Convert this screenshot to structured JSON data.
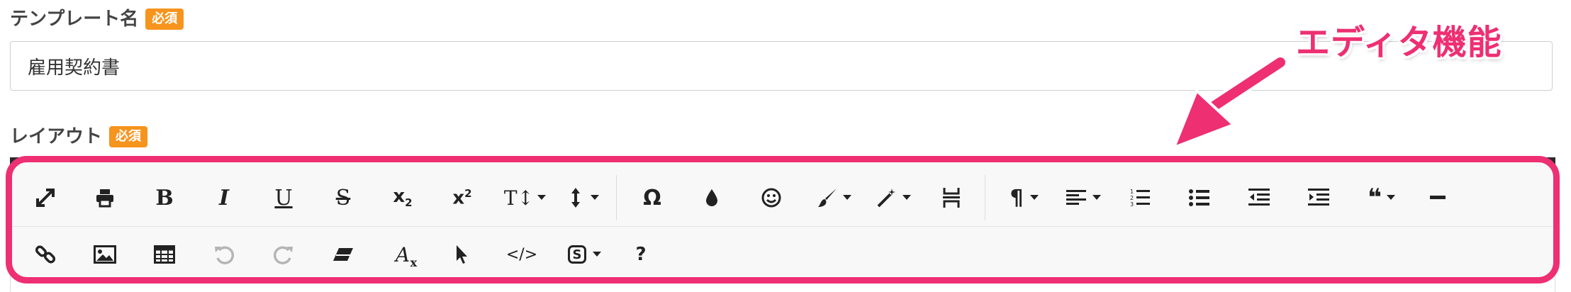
{
  "template_name": {
    "label": "テンプレート名",
    "required_badge": "必須",
    "value": "雇用契約書"
  },
  "layout": {
    "label": "レイアウト",
    "required_badge": "必須"
  },
  "annotation": {
    "text": "エディタ機能",
    "color": "#ee2f72"
  },
  "toolbar": {
    "row1": [
      "fullscreen-icon",
      "print-icon",
      "bold-icon",
      "italic-icon",
      "underline-icon",
      "strikethrough-icon",
      "subscript-icon",
      "superscript-icon",
      "font-size-icon",
      "line-height-icon",
      "special-characters-icon",
      "text-color-icon",
      "emoticons-icon",
      "paint-brush-icon",
      "magic-wand-icon",
      "page-break-icon",
      "paragraph-format-icon",
      "align-icon",
      "ordered-list-icon",
      "unordered-list-icon",
      "outdent-icon",
      "indent-icon",
      "quote-icon",
      "horizontal-line-icon"
    ],
    "row2": [
      "link-icon",
      "image-icon",
      "table-icon",
      "undo-icon",
      "redo-icon",
      "eraser-icon",
      "clear-formatting-icon",
      "select-all-icon",
      "code-view-icon",
      "symbol-icon",
      "help-icon"
    ],
    "glyphs": {
      "bold": "B",
      "italic": "I",
      "underline": "U",
      "strikethrough": "S",
      "subscript_base": "x",
      "subscript_index": "2",
      "superscript_base": "x",
      "superscript_index": "2",
      "font_size": "T",
      "special_characters": "Ω",
      "paragraph": "¶",
      "quote": "❝",
      "code": "</>",
      "help": "?",
      "symbol": "S"
    },
    "icon_color": "#222222",
    "disabled_color": "#b5b5b5"
  }
}
